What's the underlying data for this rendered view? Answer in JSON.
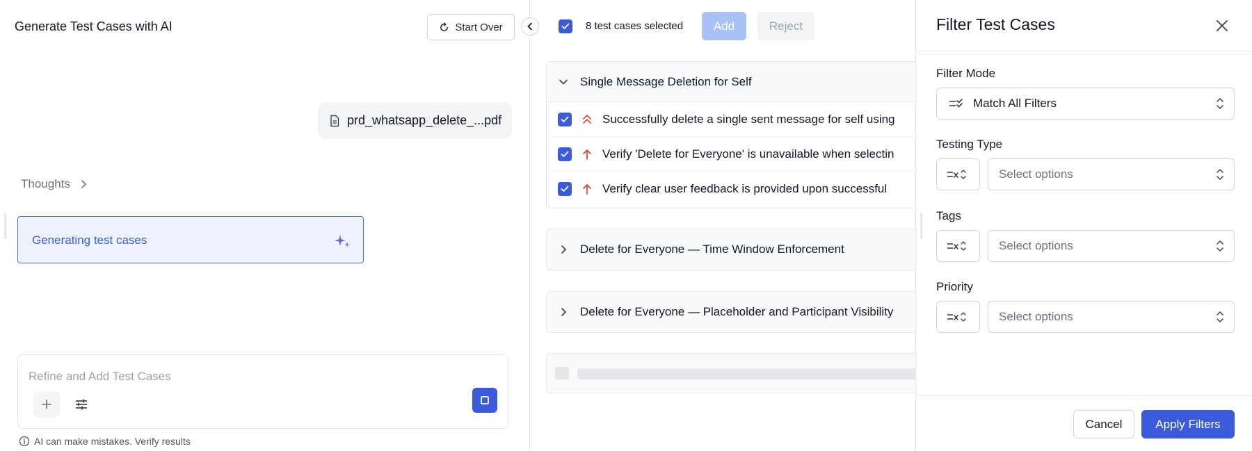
{
  "left_panel": {
    "title": "Generate Test Cases with AI",
    "start_over_label": "Start Over",
    "file_name": "prd_whatsapp_delete_...pdf",
    "thoughts_label": "Thoughts",
    "generating_label": "Generating test cases",
    "composer_placeholder": "Refine and Add Test Cases",
    "disclaimer": "AI can make mistakes. Verify results"
  },
  "results": {
    "selected_text": "8 test cases selected",
    "add_label": "Add",
    "reject_label": "Reject",
    "groups": [
      {
        "title": "Single Message Deletion for Self",
        "expanded": true,
        "test_cases": [
          {
            "title": "Successfully delete a single sent message for self using",
            "priority_icon": "double-chevron-up-icon",
            "checked": true
          },
          {
            "title": "Verify 'Delete for Everyone' is unavailable when selectin",
            "priority_icon": "arrow-up-icon",
            "checked": true
          },
          {
            "title": "Verify clear user feedback is provided upon successful",
            "priority_icon": "arrow-up-icon",
            "checked": true
          }
        ]
      },
      {
        "title": "Delete for Everyone — Time Window Enforcement",
        "expanded": false
      },
      {
        "title": "Delete for Everyone — Placeholder and Participant Visibility",
        "expanded": false
      }
    ]
  },
  "filter_drawer": {
    "title": "Filter Test Cases",
    "filter_mode_label": "Filter Mode",
    "filter_mode_value": "Match All Filters",
    "testing_type_label": "Testing Type",
    "testing_type_placeholder": "Select options",
    "tags_label": "Tags",
    "tags_placeholder": "Select options",
    "priority_label": "Priority",
    "priority_placeholder": "Select options",
    "cancel_label": "Cancel",
    "apply_label": "Apply Filters"
  },
  "colors": {
    "accent": "#3b5bdb",
    "accent_disabled": "#a9c2f5",
    "priority_red": "#dc4a3a",
    "generating_bg": "#eef3fd"
  }
}
